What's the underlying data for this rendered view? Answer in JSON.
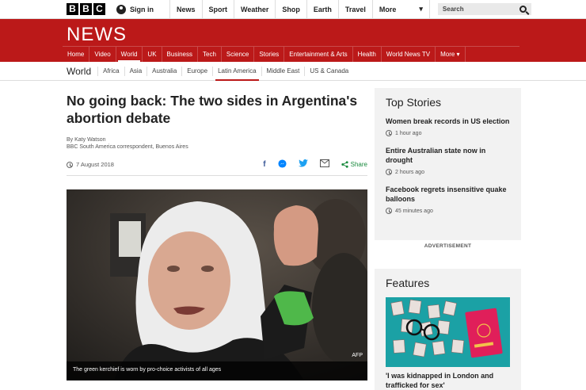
{
  "topbar": {
    "logo_letters": [
      "B",
      "B",
      "C"
    ],
    "signin": "Sign in",
    "nav": [
      "News",
      "Sport",
      "Weather",
      "Shop",
      "Earth",
      "Travel"
    ],
    "more": "More",
    "search_placeholder": "Search"
  },
  "banner": {
    "title": "NEWS",
    "nav": [
      "Home",
      "Video",
      "World",
      "UK",
      "Business",
      "Tech",
      "Science",
      "Stories",
      "Entertainment & Arts",
      "Health",
      "World News TV",
      "More ▾"
    ],
    "active": "World"
  },
  "section": {
    "title": "World",
    "nav": [
      "Africa",
      "Asia",
      "Australia",
      "Europe",
      "Latin America",
      "Middle East",
      "US & Canada"
    ],
    "active": "Latin America"
  },
  "article": {
    "headline": "No going back: The two sides in Argentina's abortion debate",
    "author": "By Katy Watson",
    "role": "BBC South America correspondent, Buenos Aires",
    "date": "7 August 2018",
    "share": "Share",
    "photo_caption": "The green kerchief is worn by pro-choice activists of all ages",
    "photo_credit": "AFP"
  },
  "top_stories": {
    "heading": "Top Stories",
    "items": [
      {
        "title": "Women break records in US election",
        "time": "1 hour ago"
      },
      {
        "title": "Entire Australian state now in drought",
        "time": "2 hours ago"
      },
      {
        "title": "Facebook regrets insensitive quake balloons",
        "time": "45 minutes ago"
      }
    ]
  },
  "advertisement": "ADVERTISEMENT",
  "features": {
    "heading": "Features",
    "item_title": "'I was kidnapped in London and trafficked for sex'"
  },
  "colors": {
    "brand_red": "#bb1919",
    "share_green": "#1a8a3e",
    "feature_teal": "#1ba1a5"
  }
}
